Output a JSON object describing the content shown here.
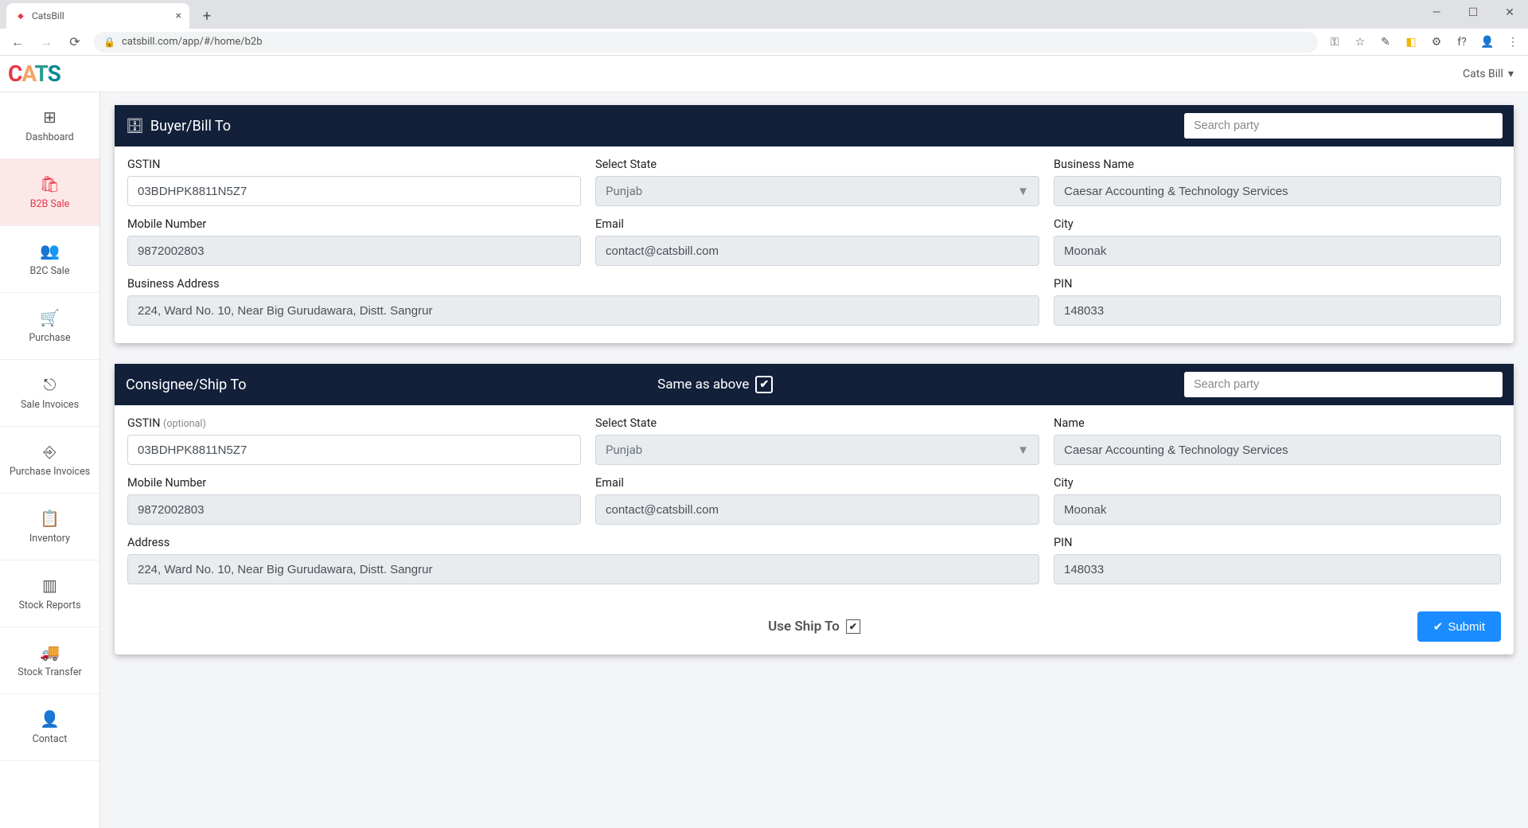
{
  "browser": {
    "tab_title": "CatsBill",
    "url": "catsbill.com/app/#/home/b2b"
  },
  "header": {
    "logo_c1": "C",
    "logo_c2": "A",
    "logo_c3": "T",
    "logo_c4": "S",
    "user_menu": "Cats Bill"
  },
  "sidebar": [
    {
      "icon": "⊞",
      "label": "Dashboard"
    },
    {
      "icon": "🛍",
      "label": "B2B Sale"
    },
    {
      "icon": "👥",
      "label": "B2C Sale"
    },
    {
      "icon": "🛒",
      "label": "Purchase"
    },
    {
      "icon": "⎋",
      "label": "Sale Invoices"
    },
    {
      "icon": "⎆",
      "label": "Purchase Invoices"
    },
    {
      "icon": "📋",
      "label": "Inventory"
    },
    {
      "icon": "▥",
      "label": "Stock Reports"
    },
    {
      "icon": "🚚",
      "label": "Stock Transfer"
    },
    {
      "icon": "👤",
      "label": "Contact"
    }
  ],
  "buyer": {
    "header_title": "Buyer/Bill To",
    "search_placeholder": "Search party",
    "labels": {
      "gstin": "GSTIN",
      "state": "Select State",
      "business_name": "Business Name",
      "mobile": "Mobile Number",
      "email": "Email",
      "city": "City",
      "address": "Business Address",
      "pin": "PIN"
    },
    "values": {
      "gstin": "03BDHPK8811N5Z7",
      "state": "Punjab",
      "business_name": "Caesar Accounting & Technology Services",
      "mobile": "9872002803",
      "email": "contact@catsbill.com",
      "city": "Moonak",
      "address": "224, Ward No. 10, Near Big Gurudawara, Distt. Sangrur",
      "pin": "148033"
    }
  },
  "consignee": {
    "header_title": "Consignee/Ship To",
    "same_as_above_label": "Same as above",
    "search_placeholder": "Search party",
    "labels": {
      "gstin": "GSTIN",
      "gstin_opt": "(optional)",
      "state": "Select State",
      "name": "Name",
      "mobile": "Mobile Number",
      "email": "Email",
      "city": "City",
      "address": "Address",
      "pin": "PIN"
    },
    "values": {
      "gstin": "03BDHPK8811N5Z7",
      "state": "Punjab",
      "name": "Caesar Accounting & Technology Services",
      "mobile": "9872002803",
      "email": "contact@catsbill.com",
      "city": "Moonak",
      "address": "224, Ward No. 10, Near Big Gurudawara, Distt. Sangrur",
      "pin": "148033"
    },
    "use_ship_label": "Use Ship To",
    "submit_label": "Submit"
  }
}
